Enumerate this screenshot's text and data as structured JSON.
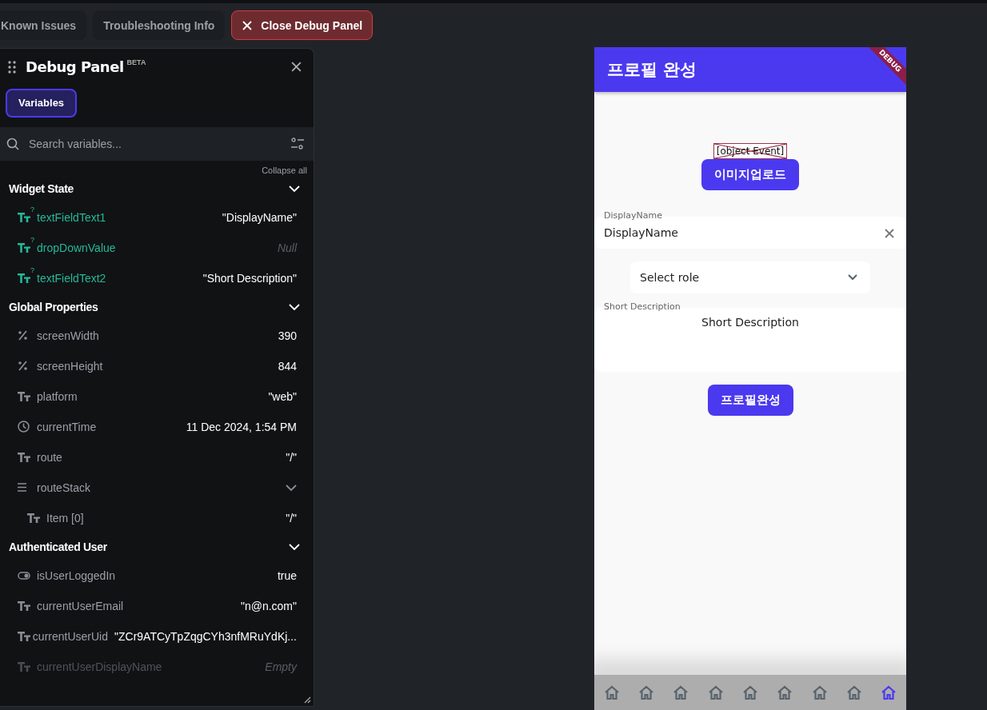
{
  "toolbar": {
    "buttons": [
      {
        "label": "Known Issues",
        "kind": "plain"
      },
      {
        "label": "Troubleshooting Info",
        "kind": "plain"
      },
      {
        "label": "Close Debug Panel",
        "kind": "danger"
      }
    ]
  },
  "debug_panel": {
    "title": "Debug Panel",
    "badge": "BETA",
    "tabs": [
      {
        "label": "Variables",
        "selected": true
      }
    ],
    "search": {
      "placeholder": "Search variables..."
    },
    "collapse_all": "Collapse all",
    "sections": [
      {
        "title": "Widget State",
        "expanded": true,
        "items": [
          {
            "kind": "string",
            "name": "textFieldText1",
            "mark": "?",
            "value": "\"DisplayName\"",
            "unset": false,
            "dimmed": false
          },
          {
            "kind": "string",
            "name": "dropDownValue",
            "mark": "?",
            "value": "Null",
            "unset": true,
            "dimmed": false
          },
          {
            "kind": "string",
            "name": "textFieldText2",
            "mark": "?",
            "value": "\"Short Description\"",
            "unset": false,
            "dimmed": false
          }
        ]
      },
      {
        "title": "Global Properties",
        "expanded": true,
        "items": [
          {
            "kind": "number",
            "name": "screenWidth",
            "value": "390",
            "unset": false,
            "dimmed": false
          },
          {
            "kind": "number",
            "name": "screenHeight",
            "value": "844",
            "unset": false,
            "dimmed": false
          },
          {
            "kind": "string",
            "name": "platform",
            "value": "\"web\"",
            "unset": false,
            "dimmed": false
          },
          {
            "kind": "datetime",
            "name": "currentTime",
            "value": "11 Dec 2024, 1:54 PM",
            "unset": false,
            "dimmed": false
          },
          {
            "kind": "string",
            "name": "route",
            "value": "\"/\"",
            "unset": false,
            "dimmed": false
          },
          {
            "kind": "list",
            "name": "routeStack",
            "expanded": true,
            "dimmed": false,
            "children": [
              {
                "kind": "string",
                "name": "Item [0]",
                "value": "\"/\"",
                "unset": false,
                "dimmed": false
              }
            ]
          }
        ]
      },
      {
        "title": "Authenticated User",
        "expanded": true,
        "items": [
          {
            "kind": "boolean",
            "name": "isUserLoggedIn",
            "value": "true",
            "unset": false,
            "dimmed": false
          },
          {
            "kind": "string",
            "name": "currentUserEmail",
            "value": "\"n@n.com\"",
            "unset": false,
            "dimmed": false
          },
          {
            "kind": "string",
            "name": "currentUserUid",
            "value": "\"ZCr9ATCyTpZqgCYh3nfMRuYdKj...",
            "unset": false,
            "dimmed": false
          },
          {
            "kind": "string",
            "name": "currentUserDisplayName",
            "value": "Empty",
            "unset": true,
            "dimmed": true
          }
        ]
      }
    ]
  },
  "phone": {
    "app_bar": {
      "title": "프로필 완성"
    },
    "debug_banner": "DEBUG",
    "broken_image": {
      "alt": "[object Event]"
    },
    "upload_button": "이미지업로드",
    "display_name_field": {
      "label": "DisplayName",
      "value": "DisplayName"
    },
    "role_dropdown": {
      "placeholder": "Select role"
    },
    "description_field": {
      "label": "Short Description",
      "value": "Short Description"
    },
    "submit_button": "프로필완성",
    "nav_bar": {
      "items": [
        {
          "selected": false
        },
        {
          "selected": false
        },
        {
          "selected": false
        },
        {
          "selected": false
        },
        {
          "selected": false
        },
        {
          "selected": false
        },
        {
          "selected": false
        },
        {
          "selected": false
        },
        {
          "selected": true
        }
      ]
    }
  }
}
